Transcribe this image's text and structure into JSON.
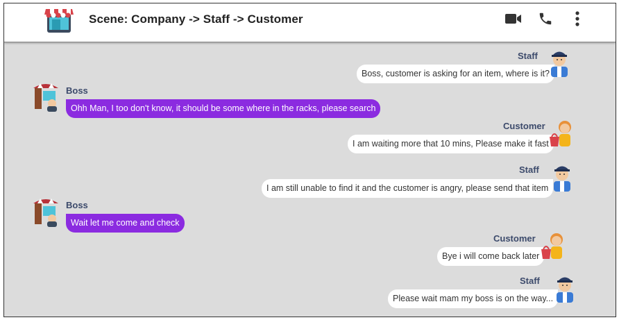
{
  "header": {
    "title": "Scene: Company -> Staff -> Customer",
    "icons": [
      "shop-icon",
      "video-call-icon",
      "phone-icon",
      "more-vert-icon"
    ]
  },
  "colors": {
    "chat_bg": "#dcdcdc",
    "boss_bubble": "#8b2be0",
    "other_bubble": "#ffffff",
    "name_text": "#3c4a6b"
  },
  "messages": [
    {
      "sender": "Staff",
      "text": "Boss, customer is asking for an item, where is it?",
      "side": "right",
      "avatar": "staff-avatar"
    },
    {
      "sender": "Boss",
      "text": "Ohh Man, I too don't know, it should be some where in the racks, please search",
      "side": "left",
      "avatar": "boss-avatar"
    },
    {
      "sender": "Customer",
      "text": "I am waiting more that 10 mins, Please make it fast",
      "side": "right",
      "avatar": "customer-avatar"
    },
    {
      "sender": "Staff",
      "text": "I am still unable to find it and the customer is angry, please send that item",
      "side": "right",
      "avatar": "staff-avatar"
    },
    {
      "sender": "Boss",
      "text": "Wait let me come and check",
      "side": "left",
      "avatar": "boss-avatar"
    },
    {
      "sender": "Customer",
      "text": "Bye i will come back later",
      "side": "right",
      "avatar": "customer-avatar"
    },
    {
      "sender": "Staff",
      "text": "Please wait mam my boss is on the way...",
      "side": "right",
      "avatar": "staff-avatar"
    }
  ]
}
